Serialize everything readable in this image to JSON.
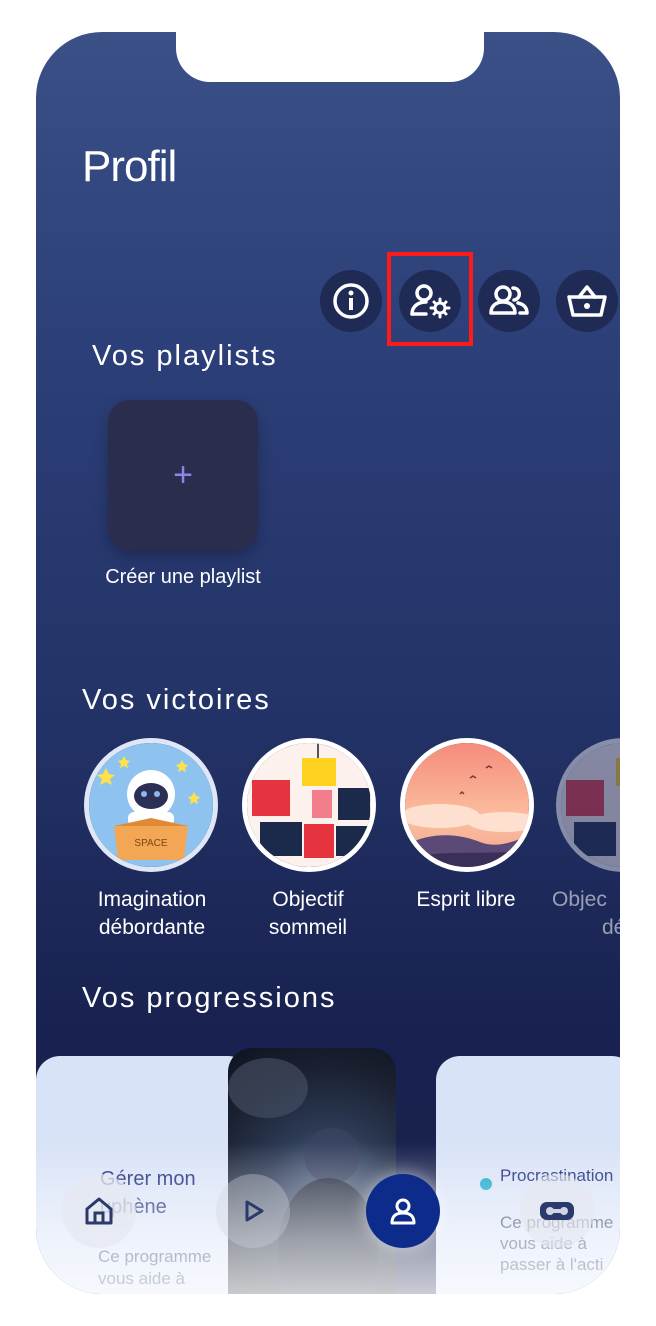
{
  "header": {
    "title": "Profil"
  },
  "icons": {
    "info": "info-icon",
    "account_settings": "user-settings-icon",
    "friends": "users-icon",
    "shop": "basket-icon"
  },
  "playlists": {
    "heading": "Vos playlists",
    "create_symbol": "+",
    "create_label": "Créer une playlist"
  },
  "victories": {
    "heading": "Vos victoires",
    "items": [
      {
        "label_line1": "Imagination",
        "label_line2": "débordante"
      },
      {
        "label_line1": "Objectif",
        "label_line2": "sommeil"
      },
      {
        "label_line1": "Esprit libre",
        "label_line2": ""
      },
      {
        "label_line1": "Objec",
        "label_line2": "dé"
      }
    ]
  },
  "progressions": {
    "heading": "Vos progressions",
    "cards": [
      {
        "title": "Gérer mon",
        "title2": "uphène",
        "desc1": "Ce programme",
        "desc2": "vous aide à"
      },
      {
        "title": "Procrastination",
        "desc1": "Ce programme",
        "desc2": "vous aide à",
        "desc3": "passer à l'acti"
      }
    ]
  },
  "space_box_text": "SPACE",
  "colors": {
    "accent": "#1a2a8a",
    "highlight": "#ff1a1a",
    "dot": "#1aa7c9"
  }
}
